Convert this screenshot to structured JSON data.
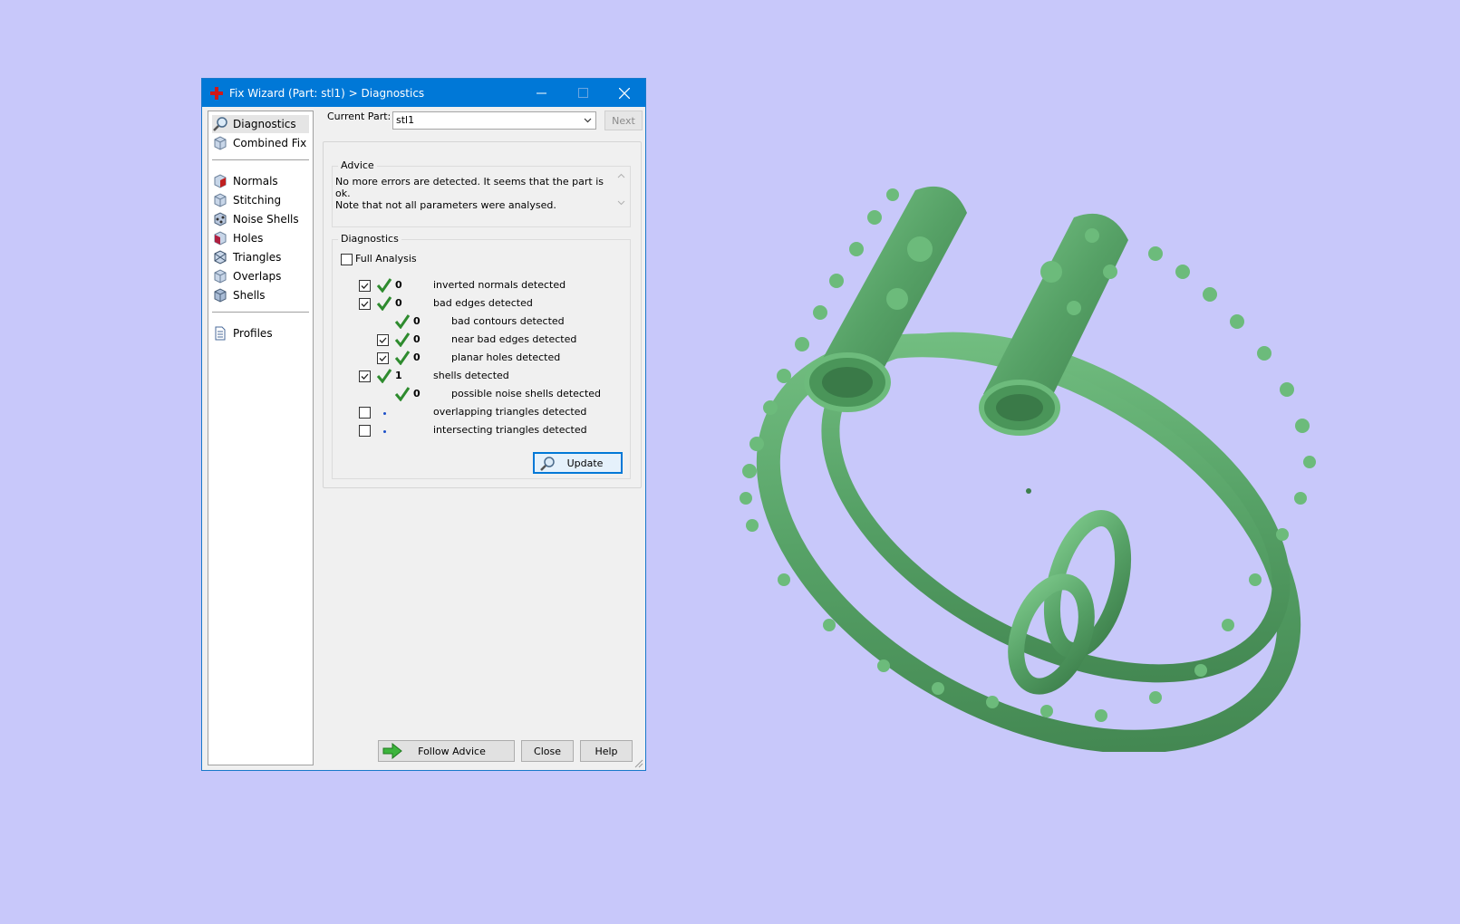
{
  "window": {
    "title": "Fix Wizard (Part: stl1) > Diagnostics"
  },
  "sidebar": {
    "items": [
      {
        "label": "Diagnostics",
        "icon": "magnifier-icon"
      },
      {
        "label": "Combined Fix",
        "icon": "cube-icon"
      },
      {
        "label": "Normals",
        "icon": "normals-cube-icon"
      },
      {
        "label": "Stitching",
        "icon": "stitching-cube-icon"
      },
      {
        "label": "Noise Shells",
        "icon": "noise-shells-icon"
      },
      {
        "label": "Holes",
        "icon": "holes-cube-icon"
      },
      {
        "label": "Triangles",
        "icon": "triangles-cube-icon"
      },
      {
        "label": "Overlaps",
        "icon": "overlaps-cube-icon"
      },
      {
        "label": "Shells",
        "icon": "shells-cube-icon"
      },
      {
        "label": "Profiles",
        "icon": "document-icon"
      }
    ]
  },
  "header": {
    "current_part_label": "Current Part:",
    "current_part_value": "stl1",
    "next_label": "Next"
  },
  "advice": {
    "title": "Advice",
    "line1": "No more errors are detected. It seems that the part is ok.",
    "line2": "Note that not all parameters were analysed."
  },
  "diagnostics": {
    "title": "Diagnostics",
    "full_analysis_label": "Full Analysis",
    "full_analysis_checked": false,
    "rows": [
      {
        "count": "0",
        "label": "inverted normals detected",
        "checked": true,
        "status": "ok"
      },
      {
        "count": "0",
        "label": "bad edges detected",
        "checked": true,
        "status": "ok"
      },
      {
        "count": "0",
        "label": "bad contours detected",
        "checked": null,
        "status": "ok"
      },
      {
        "count": "0",
        "label": "near bad edges detected",
        "checked": true,
        "status": "ok"
      },
      {
        "count": "0",
        "label": "planar holes detected",
        "checked": true,
        "status": "ok"
      },
      {
        "count": "1",
        "label": "shells detected",
        "checked": true,
        "status": "ok"
      },
      {
        "count": "0",
        "label": "possible noise shells detected",
        "checked": null,
        "status": "ok"
      },
      {
        "count": "",
        "label": "overlapping triangles detected",
        "checked": false,
        "status": "not-analysed"
      },
      {
        "count": "",
        "label": "intersecting triangles detected",
        "checked": false,
        "status": "not-analysed"
      }
    ],
    "update_label": "Update"
  },
  "footer": {
    "follow_advice_label": "Follow Advice",
    "close_label": "Close",
    "help_label": "Help"
  },
  "colors": {
    "background": "#c8c8fa",
    "titlebar": "#0078d7",
    "model_green": "#5aa86a",
    "check_green": "#2e8b2e"
  }
}
